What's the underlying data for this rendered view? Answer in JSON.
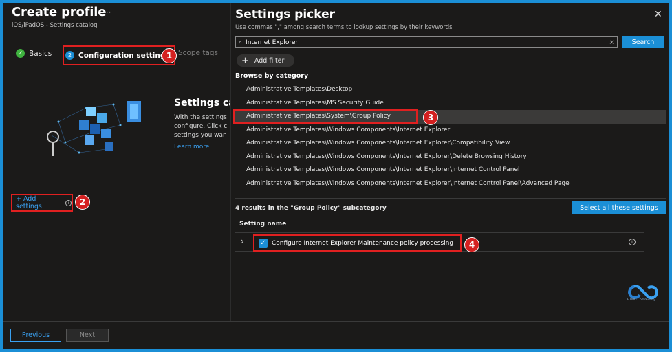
{
  "profile": {
    "title": "Create profile",
    "more": "···",
    "subtitle": "iOS/iPadOS - Settings catalog",
    "steps": [
      {
        "label": "Basics",
        "state": "done"
      },
      {
        "label": "Configuration settings",
        "number": "2",
        "state": "active"
      },
      {
        "label": "Scope tags",
        "state": "disabled"
      }
    ],
    "empty_state": {
      "title": "Settings cat",
      "lines": [
        "With the settings",
        "configure. Click c",
        "settings you wan"
      ],
      "link": "Learn more"
    },
    "add_settings": "+ Add settings",
    "footer": {
      "previous": "Previous",
      "next": "Next"
    }
  },
  "annotations": [
    "1",
    "2",
    "3",
    "4"
  ],
  "picker": {
    "title": "Settings picker",
    "subtitle": "Use commas \",\" among search terms to lookup settings by their keywords",
    "search_value": "Internet Explorer",
    "search_button": "Search",
    "clear": "×",
    "add_filter": "Add filter",
    "browse_heading": "Browse by category",
    "categories": [
      "Administrative Templates\\Desktop",
      "Administrative Templates\\MS Security Guide",
      "Administrative Templates\\System\\Group Policy",
      "Administrative Templates\\Windows Components\\Internet Explorer",
      "Administrative Templates\\Windows Components\\Internet Explorer\\Compatibility View",
      "Administrative Templates\\Windows Components\\Internet Explorer\\Delete Browsing History",
      "Administrative Templates\\Windows Components\\Internet Explorer\\Internet Control Panel",
      "Administrative Templates\\Windows Components\\Internet Explorer\\Internet Control Panel\\Advanced Page"
    ],
    "selected_category_index": 2,
    "results_text": "4 results in the \"Group Policy\" subcategory",
    "select_all": "Select all these settings",
    "column_header": "Setting name",
    "settings": [
      {
        "label": "Configure Internet Explorer Maintenance policy processing",
        "checked": true
      }
    ],
    "logo_text": "HTMD Community"
  },
  "colors": {
    "accent": "#1b8fd6",
    "annotation": "#e02020",
    "success": "#3fb33f"
  }
}
